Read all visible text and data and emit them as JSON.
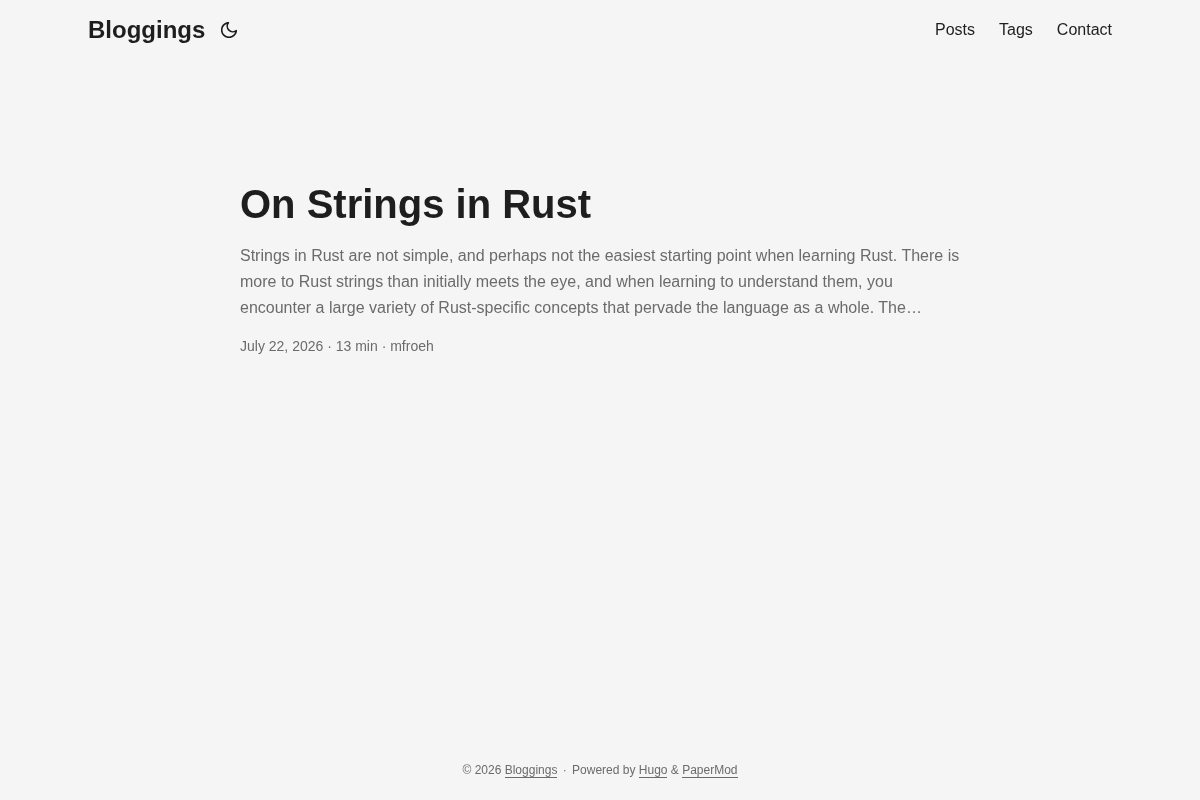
{
  "header": {
    "logo": "Bloggings",
    "nav": [
      {
        "label": "Posts"
      },
      {
        "label": "Tags"
      },
      {
        "label": "Contact"
      }
    ]
  },
  "post": {
    "title": "On Strings in Rust",
    "summary": "Strings in Rust are not simple, and perhaps not the easiest starting point when learning Rust. There is more to Rust strings than initially meets the eye, and when learning to understand them, you encounter a large variety of Rust-specific concepts that pervade the language as a whole. The…",
    "meta": "July 22, 2026 · 13 min · mfroeh"
  },
  "footer": {
    "copyright": "© 2026",
    "site_link": "Bloggings",
    "separator": "·",
    "powered_by": "Powered by",
    "links": [
      {
        "label": "Hugo"
      },
      {
        "label": "PaperMod"
      }
    ],
    "joiner": "&"
  }
}
